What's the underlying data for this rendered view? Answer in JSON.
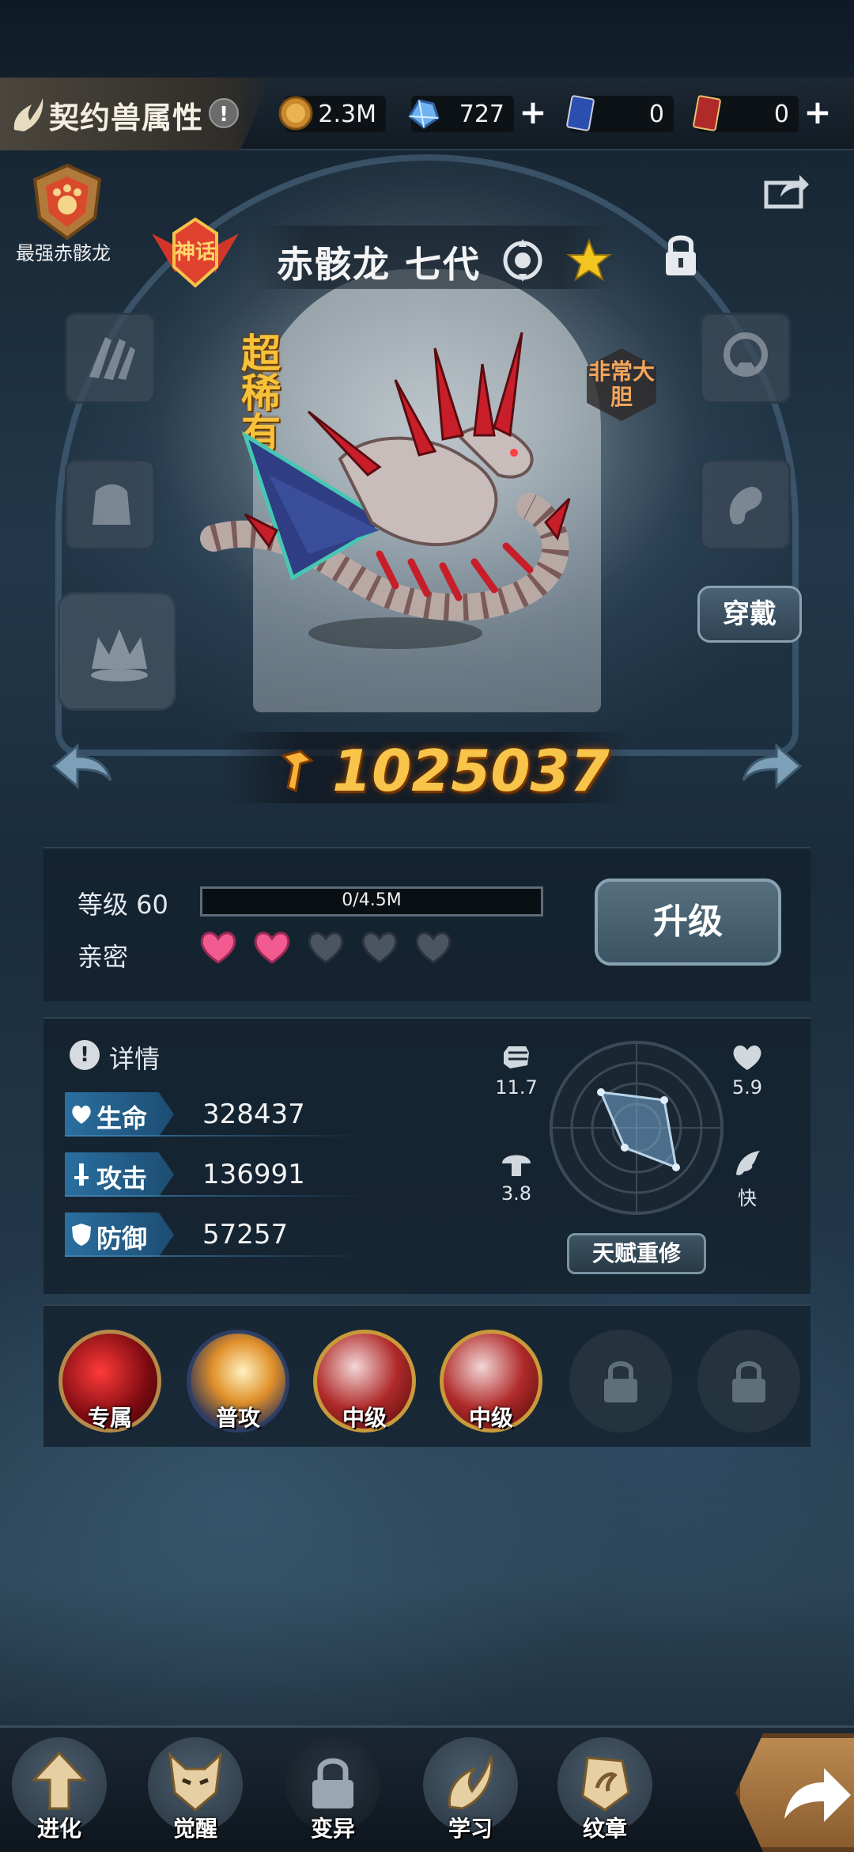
{
  "header": {
    "title": "契约兽属性",
    "info_glyph": "!",
    "resources": [
      {
        "icon": "gold-coin-icon",
        "value": "2.3M",
        "has_plus": false
      },
      {
        "icon": "crystal-icon",
        "value": "727",
        "has_plus": true
      },
      {
        "icon": "blue-card-icon",
        "value": "0",
        "has_plus": false
      },
      {
        "icon": "red-card-icon",
        "value": "0",
        "has_plus": true
      }
    ],
    "plus_glyph": "+"
  },
  "pet": {
    "badge_label": "最强赤骸龙",
    "name": "赤骸龙 七代",
    "rarity": "超稀有",
    "trait": "非常大胆",
    "power": "1025037",
    "wear_label": "穿戴"
  },
  "level": {
    "label": "等级 60",
    "exp_text": "0/4.5M",
    "exp_fraction": 0,
    "intimacy_label": "亲密",
    "hearts_filled": 2,
    "hearts_total": 5,
    "upgrade_label": "升级"
  },
  "details": {
    "info_glyph": "!",
    "label": "详情",
    "stats": [
      {
        "name": "生命",
        "value": "328437"
      },
      {
        "name": "攻击",
        "value": "136991"
      },
      {
        "name": "防御",
        "value": "57257"
      }
    ],
    "radar": {
      "top_left": "11.7",
      "top_right": "5.9",
      "bottom_left": "3.8",
      "bottom_right": "快"
    },
    "reroll_label": "天赋重修"
  },
  "skills": [
    {
      "label": "专属",
      "locked": false
    },
    {
      "label": "普攻",
      "locked": false
    },
    {
      "label": "中级",
      "locked": false
    },
    {
      "label": "中级",
      "locked": false
    },
    {
      "label": "",
      "locked": true
    },
    {
      "label": "",
      "locked": true
    }
  ],
  "bottom_nav": [
    {
      "label": "进化"
    },
    {
      "label": "觉醒"
    },
    {
      "label": "变异"
    },
    {
      "label": "学习"
    },
    {
      "label": "纹章"
    }
  ],
  "colors": {
    "accent_gold": "#f8c54a",
    "stat_blue": "#2a6fa0",
    "heart_pink": "#f25b8f"
  }
}
